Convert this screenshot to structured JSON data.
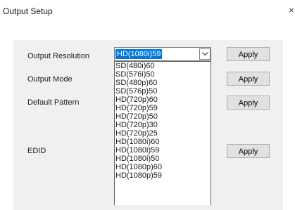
{
  "window": {
    "title": "Output Setup",
    "close_glyph": "×"
  },
  "rows": {
    "output_resolution": {
      "label": "Output Resolution",
      "apply_label": "Apply"
    },
    "output_mode": {
      "label": "Output Mode",
      "apply_label": "Apply"
    },
    "default_pattern": {
      "label": "Default Pattern",
      "apply_label": "Apply"
    },
    "edid": {
      "label": "EDID",
      "apply_label": "Apply"
    }
  },
  "resolution_combo": {
    "selected": "HD(1080i)59",
    "arrow_icon": "chevron-down-icon",
    "options": [
      "SD(480i)60",
      "SD(576i)50",
      "SD(480p)60",
      "SD(576p)50",
      "HD(720p)60",
      "HD(720p)59",
      "HD(720p)50",
      "HD(720p)30",
      "HD(720p)25",
      "HD(1080i)60",
      "HD(1080i)59",
      "HD(1080i)50",
      "HD(1080p)60",
      "HD(1080p)59"
    ]
  },
  "colors": {
    "selection": "#0078d7",
    "panel": "#f0f0f0",
    "button": "#e1e1e1"
  }
}
